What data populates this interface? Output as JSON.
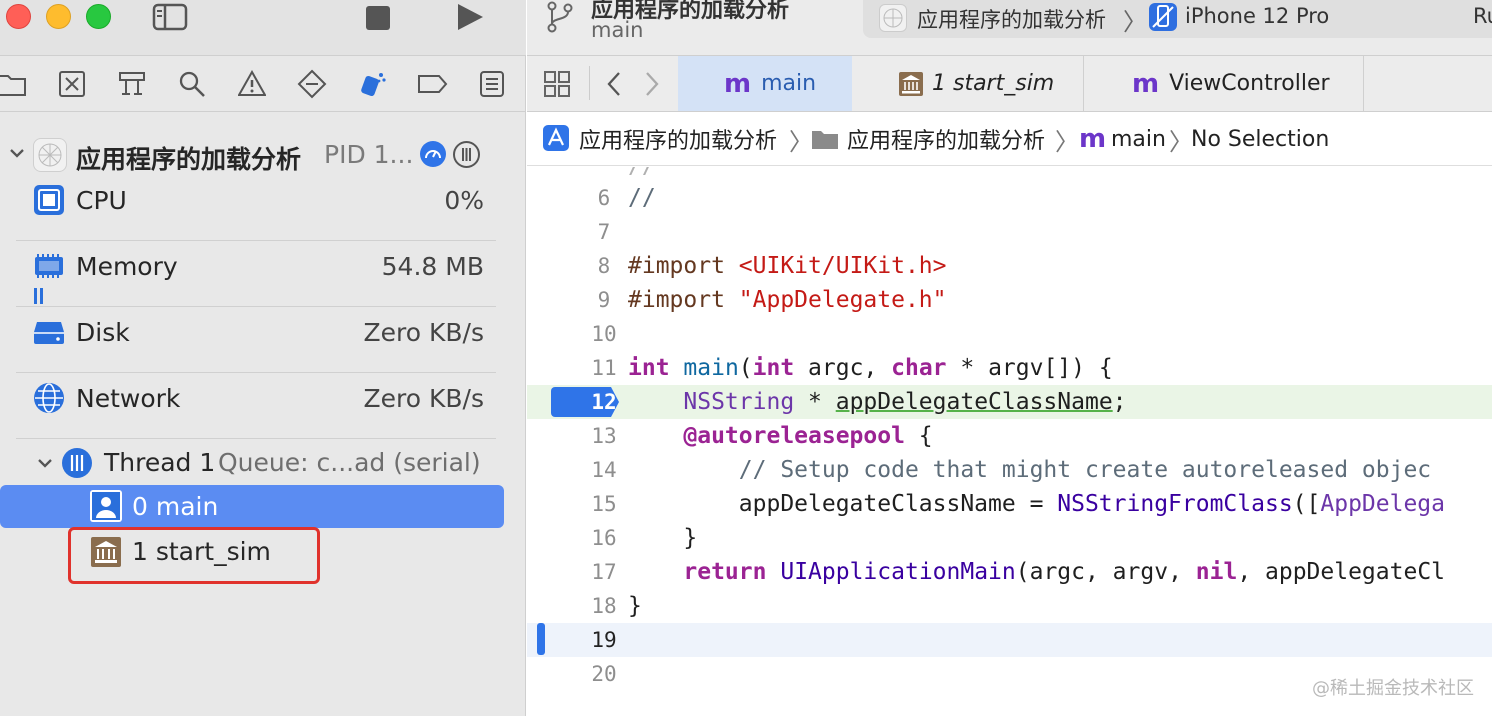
{
  "window": {
    "scheme_title": "应用程序的加载分析",
    "scheme_subtitle": "main",
    "scheme_target": "应用程序的加载分析",
    "device": "iPhone 12 Pro",
    "run_status_partial": "Ru"
  },
  "debug_navigator": {
    "process_label": "应用程序的加载分析",
    "process_pid": "PID 1...",
    "gauges": [
      {
        "name": "CPU",
        "value": "0%",
        "icon": "cpu-icon"
      },
      {
        "name": "Memory",
        "value": "54.8 MB",
        "icon": "memory-icon"
      },
      {
        "name": "Disk",
        "value": "Zero KB/s",
        "icon": "disk-icon"
      },
      {
        "name": "Network",
        "value": "Zero KB/s",
        "icon": "network-icon"
      }
    ],
    "thread_label": "Thread 1",
    "thread_queue": "Queue: c...ad (serial)",
    "frames": [
      {
        "label": "0 main",
        "selected": true,
        "icon": "user-frame-icon"
      },
      {
        "label": "1 start_sim",
        "selected": false,
        "icon": "library-frame-icon"
      }
    ]
  },
  "tabs": [
    {
      "label": "main",
      "icon": "m-file-icon",
      "active": true
    },
    {
      "label": "1 start_sim",
      "icon": "library-frame-icon",
      "active": false
    },
    {
      "label": "ViewController",
      "icon": "m-file-icon",
      "active": false
    }
  ],
  "jump_bar": {
    "project": "应用程序的加载分析",
    "group": "应用程序的加载分析",
    "file": "main",
    "selection": "No Selection"
  },
  "code_lines": [
    {
      "n": "6",
      "t": "//"
    },
    {
      "n": "7",
      "t": ""
    },
    {
      "n": "8",
      "t": "#import <UIKit/UIKit.h>"
    },
    {
      "n": "9",
      "t": "#import \"AppDelegate.h\""
    },
    {
      "n": "10",
      "t": ""
    },
    {
      "n": "11",
      "t": "int main(int argc, char * argv[]) {"
    },
    {
      "n": "12",
      "t": "    NSString * appDelegateClassName;"
    },
    {
      "n": "13",
      "t": "    @autoreleasepool {"
    },
    {
      "n": "14",
      "t": "        // Setup code that might create autoreleased objec"
    },
    {
      "n": "15",
      "t": "        appDelegateClassName = NSStringFromClass([AppDelega"
    },
    {
      "n": "16",
      "t": "    }"
    },
    {
      "n": "17",
      "t": "    return UIApplicationMain(argc, argv, nil, appDelegateCl"
    },
    {
      "n": "18",
      "t": "}"
    },
    {
      "n": "19",
      "t": ""
    },
    {
      "n": "20",
      "t": ""
    }
  ],
  "current_line": "12",
  "watermark": "@稀土掘金技术社区",
  "colors": {
    "selection_blue": "#5b8cf2",
    "current_line_green": "#eaf5e6",
    "red_highlight": "#e0322c",
    "keyword": "#9b2393",
    "string": "#c41a16"
  }
}
